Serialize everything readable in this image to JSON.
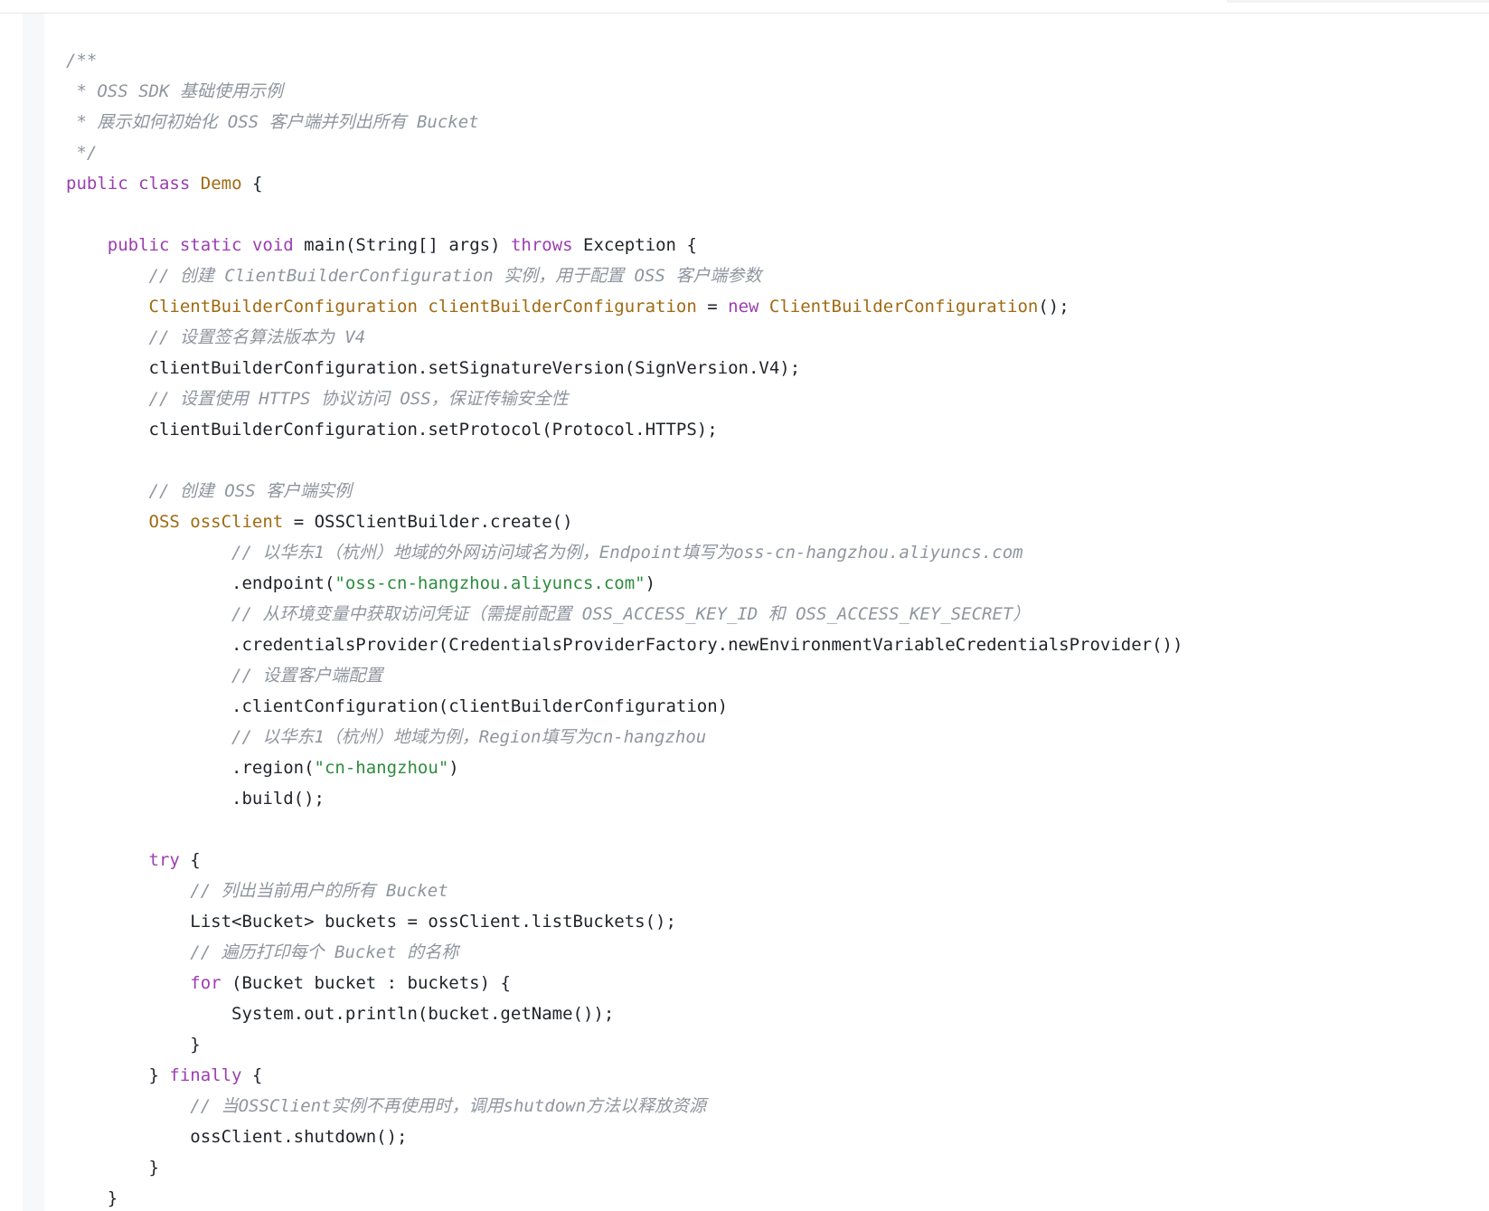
{
  "colors": {
    "background": "#ffffff",
    "comment": "#8f959e",
    "keyword": "#9b3eb0",
    "type": "#a06a12",
    "function": "#3a6fd8",
    "string": "#2e8b3e",
    "plain": "#1f2329"
  },
  "code": {
    "language": "java",
    "lines": [
      [
        {
          "t": "/**",
          "k": "comment"
        }
      ],
      [
        {
          "t": " * OSS SDK 基础使用示例",
          "k": "comment"
        }
      ],
      [
        {
          "t": " * 展示如何初始化 OSS 客户端并列出所有 Bucket",
          "k": "comment"
        }
      ],
      [
        {
          "t": " */",
          "k": "comment"
        }
      ],
      [
        {
          "t": "public",
          "k": "keyword"
        },
        {
          "t": " ",
          "k": "plain"
        },
        {
          "t": "class",
          "k": "keyword"
        },
        {
          "t": " ",
          "k": "plain"
        },
        {
          "t": "Demo",
          "k": "type"
        },
        {
          "t": " {",
          "k": "plain"
        }
      ],
      [],
      [
        {
          "t": "    ",
          "k": "plain"
        },
        {
          "t": "public",
          "k": "keyword"
        },
        {
          "t": " ",
          "k": "plain"
        },
        {
          "t": "static",
          "k": "keyword"
        },
        {
          "t": " ",
          "k": "plain"
        },
        {
          "t": "void",
          "k": "keyword"
        },
        {
          "t": " ",
          "k": "plain"
        },
        {
          "t": "main",
          "k": "function"
        },
        {
          "t": "(String[] args) ",
          "k": "plain"
        },
        {
          "t": "throws",
          "k": "keyword"
        },
        {
          "t": " Exception {",
          "k": "plain"
        }
      ],
      [
        {
          "t": "        // 创建 ClientBuilderConfiguration 实例，用于配置 OSS 客户端参数",
          "k": "comment"
        }
      ],
      [
        {
          "t": "        ",
          "k": "plain"
        },
        {
          "t": "ClientBuilderConfiguration",
          "k": "type"
        },
        {
          "t": " ",
          "k": "plain"
        },
        {
          "t": "clientBuilderConfiguration",
          "k": "type"
        },
        {
          "t": " = ",
          "k": "plain"
        },
        {
          "t": "new",
          "k": "keyword"
        },
        {
          "t": " ",
          "k": "plain"
        },
        {
          "t": "ClientBuilderConfiguration",
          "k": "type"
        },
        {
          "t": "();",
          "k": "plain"
        }
      ],
      [
        {
          "t": "        // 设置签名算法版本为 V4",
          "k": "comment"
        }
      ],
      [
        {
          "t": "        clientBuilderConfiguration.setSignatureVersion(SignVersion.V4);",
          "k": "plain"
        }
      ],
      [
        {
          "t": "        // 设置使用 HTTPS 协议访问 OSS，保证传输安全性",
          "k": "comment"
        }
      ],
      [
        {
          "t": "        clientBuilderConfiguration.setProtocol(Protocol.HTTPS);",
          "k": "plain"
        }
      ],
      [],
      [
        {
          "t": "        // 创建 OSS 客户端实例",
          "k": "comment"
        }
      ],
      [
        {
          "t": "        ",
          "k": "plain"
        },
        {
          "t": "OSS",
          "k": "type"
        },
        {
          "t": " ",
          "k": "plain"
        },
        {
          "t": "ossClient",
          "k": "type"
        },
        {
          "t": " = OSSClientBuilder.create()",
          "k": "plain"
        }
      ],
      [
        {
          "t": "                // 以华东1（杭州）地域的外网访问域名为例，Endpoint填写为oss-cn-hangzhou.aliyuncs.com",
          "k": "comment"
        }
      ],
      [
        {
          "t": "                .endpoint(",
          "k": "plain"
        },
        {
          "t": "\"oss-cn-hangzhou.aliyuncs.com\"",
          "k": "string"
        },
        {
          "t": ")",
          "k": "plain"
        }
      ],
      [
        {
          "t": "                // 从环境变量中获取访问凭证（需提前配置 OSS_ACCESS_KEY_ID 和 OSS_ACCESS_KEY_SECRET）",
          "k": "comment"
        }
      ],
      [
        {
          "t": "                .credentialsProvider(CredentialsProviderFactory.newEnvironmentVariableCredentialsProvider())",
          "k": "plain"
        }
      ],
      [
        {
          "t": "                // 设置客户端配置",
          "k": "comment"
        }
      ],
      [
        {
          "t": "                .clientConfiguration(clientBuilderConfiguration)",
          "k": "plain"
        }
      ],
      [
        {
          "t": "                // 以华东1（杭州）地域为例，Region填写为cn-hangzhou",
          "k": "comment"
        }
      ],
      [
        {
          "t": "                .region(",
          "k": "plain"
        },
        {
          "t": "\"cn-hangzhou\"",
          "k": "string"
        },
        {
          "t": ")",
          "k": "plain"
        }
      ],
      [
        {
          "t": "                .build();",
          "k": "plain"
        }
      ],
      [],
      [
        {
          "t": "        ",
          "k": "plain"
        },
        {
          "t": "try",
          "k": "keyword"
        },
        {
          "t": " {",
          "k": "plain"
        }
      ],
      [
        {
          "t": "            // 列出当前用户的所有 Bucket",
          "k": "comment"
        }
      ],
      [
        {
          "t": "            List<Bucket> buckets = ossClient.listBuckets();",
          "k": "plain"
        }
      ],
      [
        {
          "t": "            // 遍历打印每个 Bucket 的名称",
          "k": "comment"
        }
      ],
      [
        {
          "t": "            ",
          "k": "plain"
        },
        {
          "t": "for",
          "k": "keyword"
        },
        {
          "t": " (Bucket bucket : buckets) {",
          "k": "plain"
        }
      ],
      [
        {
          "t": "                System.out.println(bucket.getName());",
          "k": "plain"
        }
      ],
      [
        {
          "t": "            }",
          "k": "plain"
        }
      ],
      [
        {
          "t": "        } ",
          "k": "plain"
        },
        {
          "t": "finally",
          "k": "keyword"
        },
        {
          "t": " {",
          "k": "plain"
        }
      ],
      [
        {
          "t": "            // 当OSSClient实例不再使用时，调用shutdown方法以释放资源",
          "k": "comment"
        }
      ],
      [
        {
          "t": "            ossClient.shutdown();",
          "k": "plain"
        }
      ],
      [
        {
          "t": "        }",
          "k": "plain"
        }
      ],
      [
        {
          "t": "    }",
          "k": "plain"
        }
      ]
    ]
  }
}
